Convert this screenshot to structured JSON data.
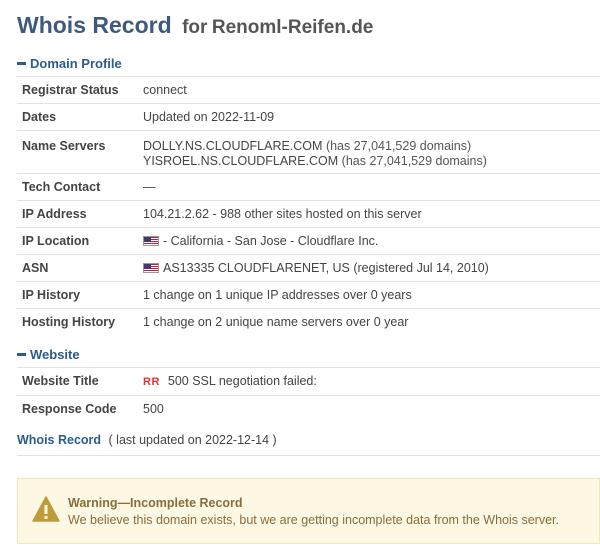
{
  "header": {
    "title": "Whois Record",
    "for_text": "for",
    "domain": "Renoml-Reifen.de"
  },
  "domain_profile": {
    "heading": "Domain Profile",
    "rows": {
      "registrar_status": {
        "label": "Registrar Status",
        "value": "connect"
      },
      "dates": {
        "label": "Dates",
        "value": "Updated on 2022-11-09"
      },
      "name_servers": {
        "label": "Name Servers",
        "ns1": "DOLLY.NS.CLOUDFLARE.COM",
        "ns1_note": "(has 27,041,529 domains)",
        "ns2": "YISROEL.NS.CLOUDFLARE.COM",
        "ns2_note": "(has 27,041,529 domains)"
      },
      "tech_contact": {
        "label": "Tech Contact",
        "value": "—"
      },
      "ip_address": {
        "label": "IP Address",
        "value": "104.21.2.62 - 988 other sites hosted on this server"
      },
      "ip_location": {
        "label": "IP Location",
        "value": "- California - San Jose - Cloudflare Inc."
      },
      "asn": {
        "label": "ASN",
        "value": "AS13335 CLOUDFLARENET, US (registered Jul 14, 2010)"
      },
      "ip_history": {
        "label": "IP History",
        "value": "1 change on 1 unique IP addresses over 0 years"
      },
      "hosting_history": {
        "label": "Hosting History",
        "value": "1 change on 2 unique name servers over 0 year"
      }
    }
  },
  "website": {
    "heading": "Website",
    "rows": {
      "website_title": {
        "label": "Website Title",
        "badge": "RR",
        "value": "500 SSL negotiation failed:"
      },
      "response_code": {
        "label": "Response Code",
        "value": "500"
      }
    }
  },
  "whois_record": {
    "link": "Whois Record",
    "note": "( last updated on 2022-12-14 )"
  },
  "warning": {
    "title": "Warning—Incomplete Record",
    "text": "We believe this domain exists, but we are getting incomplete data from the Whois server."
  },
  "colors": {
    "title_blue": "#3e5a7d",
    "link_blue": "#2d5b8e",
    "warning_bg": "#fcf8e3",
    "warning_text": "#8a6d3b",
    "warning_icon": "#c09b3a",
    "rr_red": "#e53333"
  }
}
